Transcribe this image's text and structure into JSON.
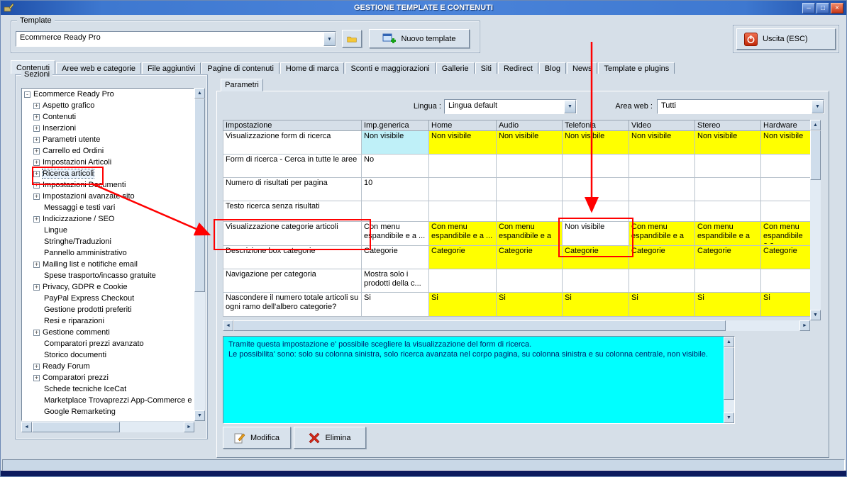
{
  "window": {
    "title": "GESTIONE TEMPLATE E CONTENUTI",
    "controls": {
      "minimize": "–",
      "maximize": "□",
      "close": "×"
    }
  },
  "icons": {
    "arrow_up": "▲",
    "arrow_down": "▼",
    "arrow_left": "◄",
    "arrow_right": "►",
    "combo_arrow": "▼"
  },
  "template_bar": {
    "group_label": "Template",
    "combo_value": "Ecommerce Ready Pro",
    "new_template_label": "Nuovo template",
    "exit_label": "Uscita (ESC)"
  },
  "tabs": [
    {
      "label": "Contenuti",
      "active": true
    },
    {
      "label": "Aree web e categorie"
    },
    {
      "label": "File aggiuntivi"
    },
    {
      "label": "Pagine di contenuti"
    },
    {
      "label": "Home di marca"
    },
    {
      "label": "Sconti e maggiorazioni"
    },
    {
      "label": "Gallerie"
    },
    {
      "label": "Siti"
    },
    {
      "label": "Redirect"
    },
    {
      "label": "Blog"
    },
    {
      "label": "News"
    },
    {
      "label": "Template e plugins"
    }
  ],
  "sezioni": {
    "group_label": "Sezioni",
    "items": [
      {
        "label": "Ecommerce Ready Pro",
        "glyph": "-",
        "root": true
      },
      {
        "label": "Aspetto grafico",
        "glyph": "+"
      },
      {
        "label": "Contenuti",
        "glyph": "+"
      },
      {
        "label": "Inserzioni",
        "glyph": "+"
      },
      {
        "label": "Parametri utente",
        "glyph": "+"
      },
      {
        "label": "Carrello ed Ordini",
        "glyph": "+"
      },
      {
        "label": "Impostazioni Articoli",
        "glyph": "+"
      },
      {
        "label": "Ricerca articoli",
        "glyph": "+",
        "selected": true
      },
      {
        "label": "Impostazioni Documenti",
        "glyph": "+"
      },
      {
        "label": "Impostazioni avanzate sito",
        "glyph": "+"
      },
      {
        "label": "Messaggi e testi vari"
      },
      {
        "label": "Indicizzazione / SEO",
        "glyph": "+"
      },
      {
        "label": "Lingue"
      },
      {
        "label": "Stringhe/Traduzioni"
      },
      {
        "label": "Pannello amministrativo"
      },
      {
        "label": "Mailing list e notifiche email",
        "glyph": "+"
      },
      {
        "label": "Spese trasporto/incasso gratuite"
      },
      {
        "label": "Privacy, GDPR e Cookie",
        "glyph": "+"
      },
      {
        "label": "PayPal Express Checkout"
      },
      {
        "label": "Gestione prodotti preferiti"
      },
      {
        "label": "Resi e riparazioni"
      },
      {
        "label": "Gestione commenti",
        "glyph": "+"
      },
      {
        "label": "Comparatori prezzi avanzato"
      },
      {
        "label": "Storico documenti"
      },
      {
        "label": "Ready Forum",
        "glyph": "+"
      },
      {
        "label": "Comparatori prezzi",
        "glyph": "+"
      },
      {
        "label": "Schede tecniche IceCat"
      },
      {
        "label": "Marketplace Trovaprezzi App-Commerce e Ki"
      },
      {
        "label": "Google Remarketing"
      }
    ]
  },
  "parametri": {
    "tab_label": "Parametri",
    "lingua_label": "Lingua :",
    "lingua_value": "Lingua default",
    "area_label": "Area web :",
    "area_value": "Tutti",
    "table": {
      "columns": [
        "Impostazione",
        "Imp.generica",
        "Home",
        "Audio",
        "Telefonia",
        "Video",
        "Stereo",
        "Hardware"
      ],
      "rows": [
        {
          "label": "Visualizzazione form di ricerca",
          "cells": [
            {
              "t": "Non visibile",
              "bg": "cyan"
            },
            {
              "t": "Non visibile",
              "bg": "yellow"
            },
            {
              "t": "Non visibile",
              "bg": "yellow"
            },
            {
              "t": "Non visibile",
              "bg": "yellow"
            },
            {
              "t": "Non visibile",
              "bg": "yellow"
            },
            {
              "t": "Non visibile",
              "bg": "yellow"
            },
            {
              "t": "Non visibile",
              "bg": "yellow"
            }
          ]
        },
        {
          "label": "Form di ricerca - Cerca in tutte le aree",
          "cells": [
            {
              "t": "No"
            },
            {},
            {},
            {},
            {},
            {},
            {}
          ]
        },
        {
          "label": "Numero di risultati per pagina",
          "cells": [
            {
              "t": "10"
            },
            {},
            {},
            {},
            {},
            {},
            {}
          ]
        },
        {
          "label": "Testo ricerca senza risultati",
          "cells": [
            {},
            {},
            {},
            {},
            {},
            {},
            {}
          ]
        },
        {
          "label": "Visualizzazione categorie articoli",
          "cells": [
            {
              "t": "Con menu espandibile e a ..."
            },
            {
              "t": "Con menu espandibile e a ...",
              "bg": "yellow"
            },
            {
              "t": "Con menu espandibile e a ...",
              "bg": "yellow"
            },
            {
              "t": "Non visibile",
              "bg": "white"
            },
            {
              "t": "Con menu espandibile e a ...",
              "bg": "yellow"
            },
            {
              "t": "Con menu espandibile e a ...",
              "bg": "yellow"
            },
            {
              "t": "Con menu espandibile e a ...",
              "bg": "yellow"
            }
          ]
        },
        {
          "label": "Descrizione box categorie",
          "cells": [
            {
              "t": "Categorie"
            },
            {
              "t": "Categorie",
              "bg": "yellow"
            },
            {
              "t": "Categorie",
              "bg": "yellow"
            },
            {
              "t": "Categorie",
              "bg": "yellow"
            },
            {
              "t": "Categorie",
              "bg": "yellow"
            },
            {
              "t": "Categorie",
              "bg": "yellow"
            },
            {
              "t": "Categorie",
              "bg": "yellow"
            }
          ]
        },
        {
          "label": "Navigazione per categoria",
          "cells": [
            {
              "t": "Mostra solo i prodotti della c..."
            },
            {},
            {},
            {},
            {},
            {},
            {}
          ]
        },
        {
          "label": "Nascondere il numero totale articoli su ogni ramo dell'albero categorie?",
          "cells": [
            {
              "t": "Si"
            },
            {
              "t": "Si",
              "bg": "yellow"
            },
            {
              "t": "Si",
              "bg": "yellow"
            },
            {
              "t": "Si",
              "bg": "yellow"
            },
            {
              "t": "Si",
              "bg": "yellow"
            },
            {
              "t": "Si",
              "bg": "yellow"
            },
            {
              "t": "Si",
              "bg": "yellow"
            }
          ]
        }
      ]
    },
    "description_lines": [
      "Tramite questa impostazione e' possibile scegliere la visualizzazione del form di ricerca.",
      "Le possibilita' sono: solo su colonna sinistra, solo ricerca avanzata nel corpo pagina, su colonna sinistra e su colonna centrale, non visibile."
    ],
    "modifica_label": "Modifica",
    "elimina_label": "Elimina"
  },
  "colors": {
    "highlight_yellow": "#FFFF00",
    "highlight_cyan": "#BFF0F8",
    "description_cyan": "#00FFFF",
    "annotation_red": "#FF0000"
  }
}
